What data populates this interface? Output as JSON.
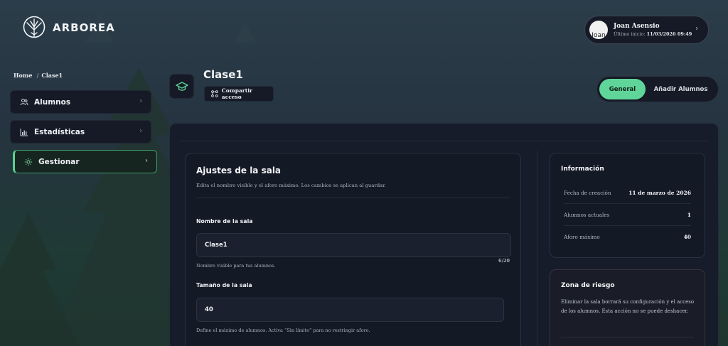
{
  "brand": {
    "name": "ARBOREA"
  },
  "user": {
    "avatar_alt": "Joan",
    "name": "Joan Asensio",
    "last_login_label": "Último inicio:",
    "last_login_value": "11/03/2026 09:49"
  },
  "breadcrumb": {
    "home": "Home",
    "sep": "/",
    "current": "Clase1"
  },
  "sidebar": {
    "items": [
      {
        "label": "Alumnos",
        "icon": "users-icon"
      },
      {
        "label": "Estadísticas",
        "icon": "bar-chart-icon"
      },
      {
        "label": "Gestionar",
        "icon": "gear-icon",
        "active": true
      }
    ]
  },
  "room": {
    "title": "Clase1",
    "icon": "graduation-cap-icon",
    "share_label": "Compartir acceso"
  },
  "tabs": {
    "general": "General",
    "add_students": "Añadir Alumnos",
    "active": "General"
  },
  "settings": {
    "title": "Ajustes de la sala",
    "description": "Edita el nombre visible y el aforo máximo. Los cambios se aplican al guardar.",
    "name_label": "Nombre de la sala",
    "name_value": "Clase1",
    "name_hint": "Nombre visible para tus alumnos.",
    "name_counter": "6/20",
    "size_label": "Tamaño de la sala",
    "size_value": "40",
    "size_hint": "Define el máximo de alumnos. Activa “Sin límite” para no restringir aforo."
  },
  "info": {
    "title": "Información",
    "rows": [
      {
        "key": "Fecha de creación",
        "value": "11 de marzo de 2026"
      },
      {
        "key": "Alumnos actuales",
        "value": "1"
      },
      {
        "key": "Aforo máximo",
        "value": "40"
      }
    ]
  },
  "danger": {
    "title": "Zona de riesgo",
    "text": "Eliminar la sala borrará su configuración y el acceso de los alumnos. Esta acción no se puede deshacer."
  },
  "colors": {
    "accent": "#5fd59a",
    "panel": "#161c29",
    "card": "#141926"
  }
}
